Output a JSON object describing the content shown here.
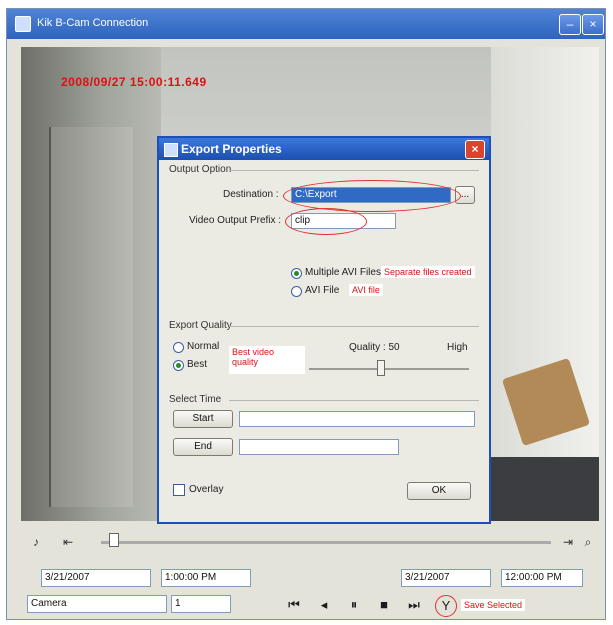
{
  "window": {
    "title": "Kik B-Cam Connection",
    "min": "–",
    "close": "×"
  },
  "video": {
    "timestamp": "2008/09/27 15:00:11.649"
  },
  "dialog": {
    "title": "Export Properties",
    "close": "×",
    "output_group": "Output Option",
    "destination_label": "Destination :",
    "destination_value": "C:\\Export",
    "browse": "...",
    "filename_label": "Video Output Prefix :",
    "filename_value": "clip",
    "option1": "Multiple AVI Files",
    "option1_note": "Separate files created",
    "option2": "AVI File",
    "option2_note": "AVI file",
    "format_group": "Export Quality",
    "radio_a": "Normal",
    "radio_b": "Best",
    "radio_note": "Best video quality",
    "quality_label": "Quality : 50",
    "quality_high": "High",
    "quality_level": 0.45,
    "time_group": "Select Time",
    "btn_start": "Start",
    "btn_end": "End",
    "checkbox_label": "Overlay",
    "ok": "OK"
  },
  "controls": {
    "left_date": "3/21/2007",
    "left_time": "1:00:00 PM",
    "right_date": "3/21/2007",
    "right_time": "12:00:00 PM",
    "camera_select": "Camera",
    "channel_select": "1",
    "note": "Save Selected"
  }
}
